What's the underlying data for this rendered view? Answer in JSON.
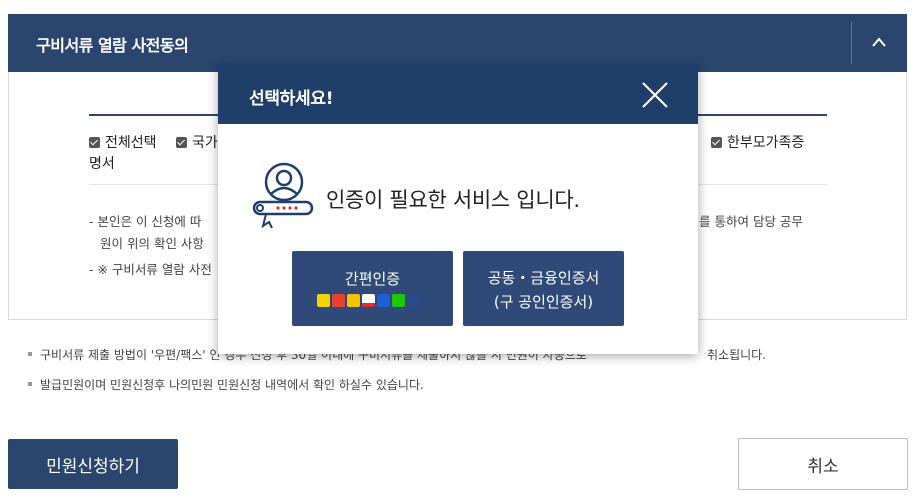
{
  "panel": {
    "title": "구비서류 열람 사전동의",
    "check_all": "전체선택",
    "check_partial": "국가",
    "check_single": "한부모가족증",
    "wrap_text": "명서",
    "notice_line1_left": "- 본인은 이 신청에 따",
    "notice_line1_right": "를 통하여 담당 공무",
    "notice_line2": "원이 위의 확인 사항",
    "notice_line3": "- ※ 구비서류 열람 사전"
  },
  "bullets": {
    "item1_left": "구비서류 제출 방법이 '우편/팩스' 인 경우 신청 후 30일 이내에 구비서류를 제출하지 않을 시 민원이 자동으로",
    "item1_right": "취소됩니다.",
    "item2": "발급민원이며 민원신청후 나의민원 민원신청 내역에서 확인 하실수 있습니다."
  },
  "footer": {
    "apply_label": "민원신청하기",
    "cancel_label": "취소"
  },
  "modal": {
    "title": "선택하세요!",
    "message": "인증이 필요한 서비스 입니다.",
    "simple_auth_label": "간편인증",
    "cert_auth_line1": "공동・금융인증서",
    "cert_auth_line2": "(구 공인인증서)",
    "providers": [
      {
        "icon": "kakao-icon",
        "color": "#f7d400"
      },
      {
        "icon": "pass-icon",
        "color": "#e9412f"
      },
      {
        "icon": "kb-icon",
        "color": "#f5c400"
      },
      {
        "icon": "samsung-pass-icon",
        "color": "#d6332a"
      },
      {
        "icon": "payco-icon",
        "color": "#1e5fd8"
      },
      {
        "icon": "naver-icon",
        "color": "#1ec800"
      },
      {
        "icon": "toss-icon",
        "color": "#2a4a8a"
      }
    ]
  },
  "colors": {
    "primary_navy": "#2a466f",
    "modal_header": "#1f3e6a",
    "auth_button": "#2f4a78"
  }
}
